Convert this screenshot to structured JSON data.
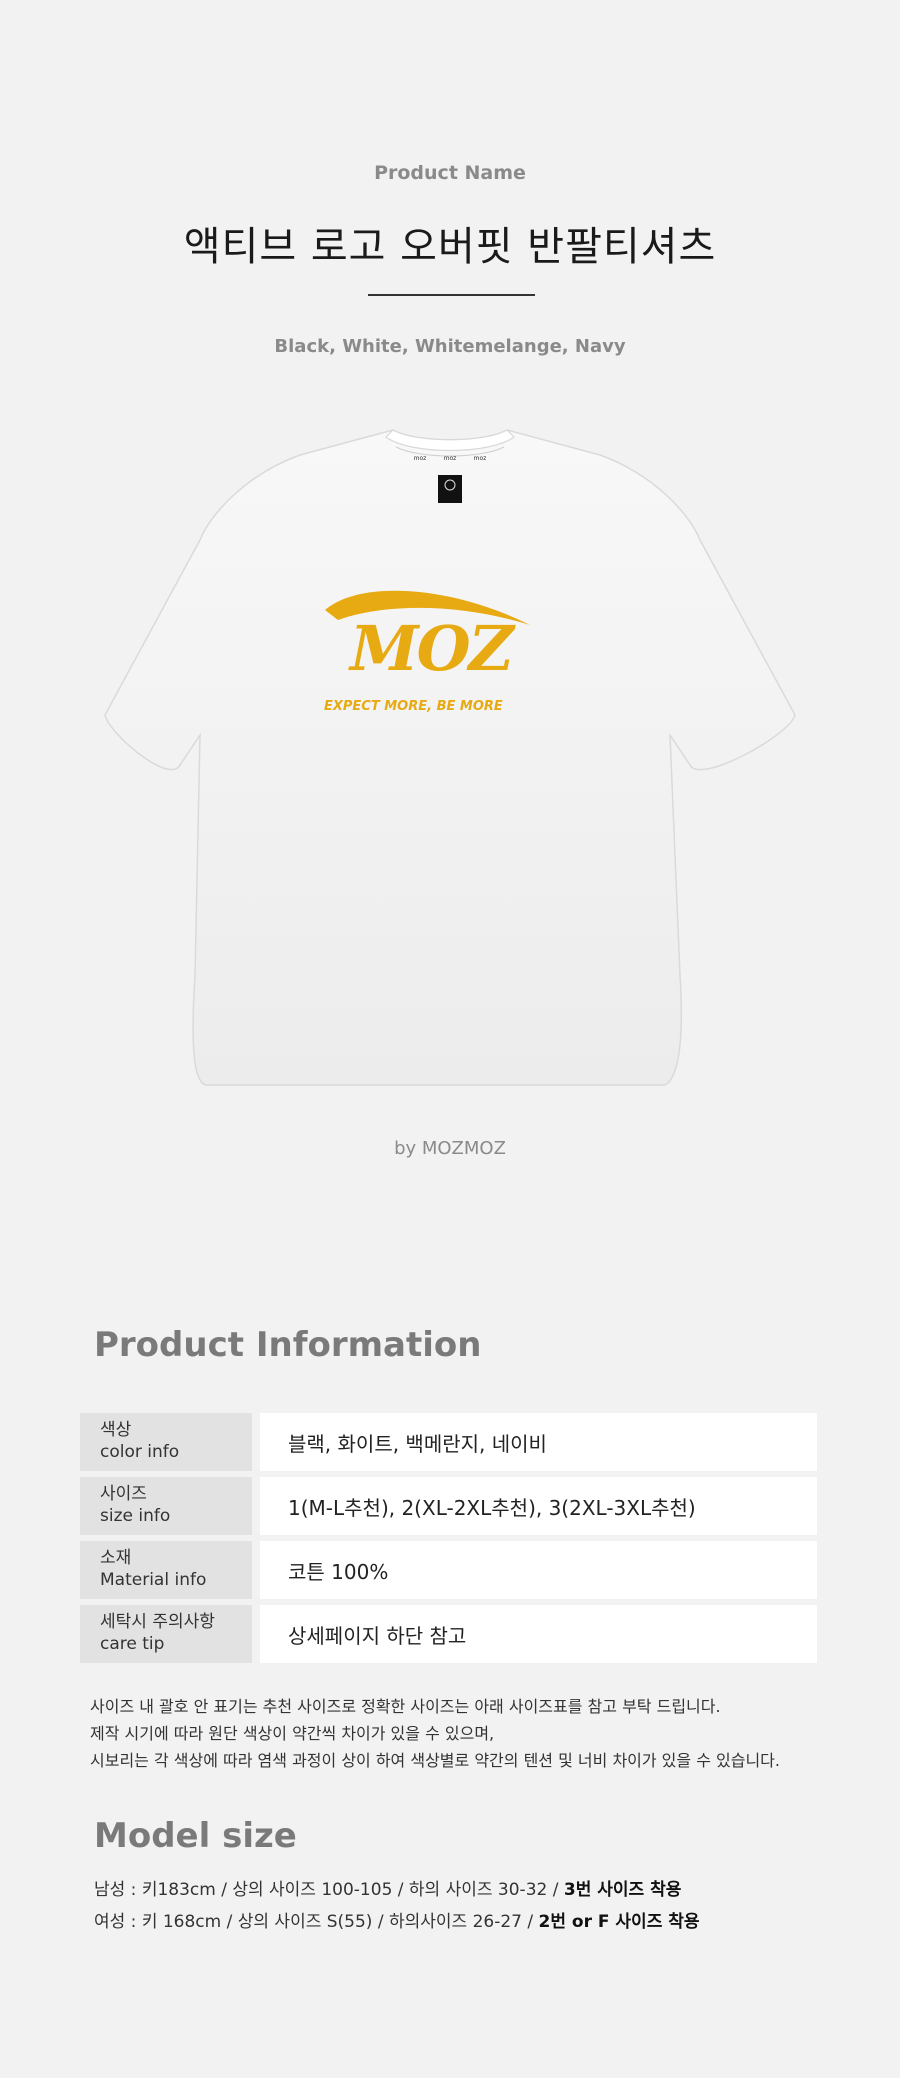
{
  "header": {
    "eyebrow": "Product Name",
    "title": "액티브 로고 오버핏 반팔티셔츠",
    "colors": "Black, White, Whitemelange, Navy"
  },
  "product_image": {
    "print_logo": "MOZ",
    "print_slogan": "EXPECT MORE, BE MORE",
    "neck_tape_text": "moz",
    "logo_color": "#E8AA12",
    "shirt_color": "#F6F6F6"
  },
  "brand_line": "by MOZMOZ",
  "product_information": {
    "heading": "Product Information",
    "rows": [
      {
        "label_ko": "색상",
        "label_en": "color info",
        "value": "블랙, 화이트, 백메란지, 네이비"
      },
      {
        "label_ko": "사이즈",
        "label_en": "size info",
        "value": "1(M-L추천), 2(XL-2XL추천), 3(2XL-3XL추천)"
      },
      {
        "label_ko": "소재",
        "label_en": "Material info",
        "value": "코튼 100%"
      },
      {
        "label_ko": "세탁시 주의사항",
        "label_en": "care tip",
        "value": "상세페이지 하단 참고"
      }
    ],
    "notes": [
      "사이즈 내 괄호 안 표기는 추천 사이즈로 정확한 사이즈는 아래 사이즈표를 참고 부탁 드립니다.",
      "제작 시기에 따라 원단 색상이 약간씩 차이가 있을 수 있으며,",
      "시보리는 각 색상에 따라 염색 과정이 상이 하여 색상별로 약간의 텐션 및 너비 차이가 있을 수 있습니다."
    ]
  },
  "model_size": {
    "heading": "Model size",
    "male_text": "남성 : 키183cm / 상의 사이즈 100-105 / 하의 사이즈 30-32 / ",
    "male_bold": "3번 사이즈 착용",
    "female_text": "여성 : 키 168cm / 상의 사이즈 S(55) / 하의사이즈 26-27 / ",
    "female_bold": "2번 or F 사이즈 착용"
  }
}
